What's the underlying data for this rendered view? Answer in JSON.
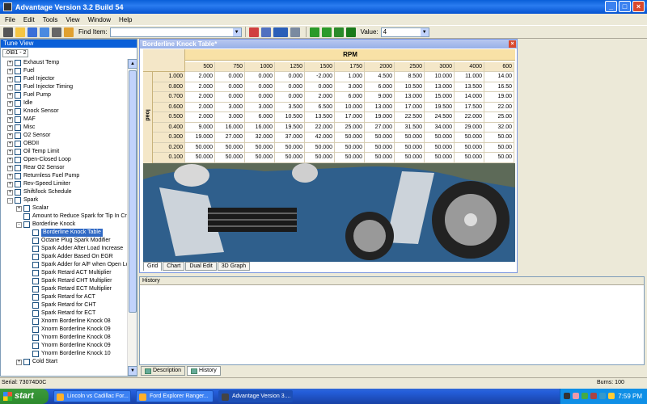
{
  "window": {
    "title": "Advantage Version 3.2 Build 54"
  },
  "menu": [
    "File",
    "Edit",
    "Tools",
    "View",
    "Window",
    "Help"
  ],
  "toolbar": {
    "find_label": "Find Item:",
    "find_value": "",
    "value_label": "Value:",
    "value_value": "4"
  },
  "tune_view": {
    "title": "Tune View",
    "tab": ".0\\B1 - 2",
    "items": [
      {
        "label": "Exhaust Temp",
        "level": 0,
        "exp": "+"
      },
      {
        "label": "Fuel",
        "level": 0,
        "exp": "+"
      },
      {
        "label": "Fuel Injector",
        "level": 0,
        "exp": "+"
      },
      {
        "label": "Fuel Injector Timing",
        "level": 0,
        "exp": "+"
      },
      {
        "label": "Fuel Pump",
        "level": 0,
        "exp": "+"
      },
      {
        "label": "Idle",
        "level": 0,
        "exp": "+"
      },
      {
        "label": "Knock Sensor",
        "level": 0,
        "exp": "+"
      },
      {
        "label": "MAF",
        "level": 0,
        "exp": "+"
      },
      {
        "label": "Misc",
        "level": 0,
        "exp": "+"
      },
      {
        "label": "O2 Sensor",
        "level": 0,
        "exp": "+"
      },
      {
        "label": "OBDII",
        "level": 0,
        "exp": "+"
      },
      {
        "label": "Oil Temp Limit",
        "level": 0,
        "exp": "+"
      },
      {
        "label": "Open-Closed Loop",
        "level": 0,
        "exp": "+"
      },
      {
        "label": "Rear O2 Sensor",
        "level": 0,
        "exp": "+"
      },
      {
        "label": "Returnless Fuel Pump",
        "level": 0,
        "exp": "+"
      },
      {
        "label": "Rev-Speed Limiter",
        "level": 0,
        "exp": "+"
      },
      {
        "label": "Shift/lock Schedule",
        "level": 0,
        "exp": "+"
      },
      {
        "label": "Spark",
        "level": 0,
        "exp": "-"
      },
      {
        "label": "Scalar",
        "level": 1,
        "exp": "+"
      },
      {
        "label": "Amount to Reduce Spark for Tip In Cnt",
        "level": 1,
        "exp": ""
      },
      {
        "label": "Borderline Knock",
        "level": 1,
        "exp": "-"
      },
      {
        "label": "Borderline Knock Table",
        "level": 2,
        "exp": "",
        "selected": true
      },
      {
        "label": "Octane Plug Spark Modifier",
        "level": 2,
        "exp": ""
      },
      {
        "label": "Spark Adder After Load Increase",
        "level": 2,
        "exp": ""
      },
      {
        "label": "Spark Adder Based On EGR",
        "level": 2,
        "exp": ""
      },
      {
        "label": "Spark Adder for A/F when Open Lo",
        "level": 2,
        "exp": ""
      },
      {
        "label": "Spark Retard ACT Multiplier",
        "level": 2,
        "exp": ""
      },
      {
        "label": "Spark Retard CHT Multiplier",
        "level": 2,
        "exp": ""
      },
      {
        "label": "Spark Retard ECT Multiplier",
        "level": 2,
        "exp": ""
      },
      {
        "label": "Spark Retard for ACT",
        "level": 2,
        "exp": ""
      },
      {
        "label": "Spark Retard for CHT",
        "level": 2,
        "exp": ""
      },
      {
        "label": "Spark Retard for ECT",
        "level": 2,
        "exp": ""
      },
      {
        "label": "Xnorm Borderline Knock 08",
        "level": 2,
        "exp": ""
      },
      {
        "label": "Xnorm Borderline Knock 09",
        "level": 2,
        "exp": ""
      },
      {
        "label": "Ynorm Borderline Knock 08",
        "level": 2,
        "exp": ""
      },
      {
        "label": "Ynorm Borderline Knock 09",
        "level": 2,
        "exp": ""
      },
      {
        "label": "Ynorm Borderline Knock 10",
        "level": 2,
        "exp": ""
      },
      {
        "label": "Cold Start",
        "level": 1,
        "exp": "+"
      }
    ]
  },
  "knock_table": {
    "title": "Borderline Knock Table*",
    "rpm_label": "RPM",
    "load_label": "load",
    "rpm": [
      "500",
      "750",
      "1000",
      "1250",
      "1500",
      "1750",
      "2000",
      "2500",
      "3000",
      "4000",
      "600"
    ],
    "rows": [
      {
        "load": "1.000",
        "vals": [
          "2.000",
          "0.000",
          "0.000",
          "0.000",
          "-2.000",
          "1.000",
          "4.500",
          "8.500",
          "10.000",
          "11.000",
          "14.00"
        ]
      },
      {
        "load": "0.800",
        "vals": [
          "2.000",
          "0.000",
          "0.000",
          "0.000",
          "0.000",
          "3.000",
          "6.000",
          "10.500",
          "13.000",
          "13.500",
          "16.50"
        ]
      },
      {
        "load": "0.700",
        "vals": [
          "2.000",
          "0.000",
          "0.000",
          "0.000",
          "2.000",
          "6.000",
          "9.000",
          "13.000",
          "15.000",
          "14.000",
          "19.00"
        ]
      },
      {
        "load": "0.600",
        "vals": [
          "2.000",
          "3.000",
          "3.000",
          "3.500",
          "6.500",
          "10.000",
          "13.000",
          "17.000",
          "19.500",
          "17.500",
          "22.00"
        ]
      },
      {
        "load": "0.500",
        "vals": [
          "2.000",
          "3.000",
          "6.000",
          "10.500",
          "13.500",
          "17.000",
          "19.000",
          "22.500",
          "24.500",
          "22.000",
          "25.00"
        ]
      },
      {
        "load": "0.400",
        "vals": [
          "9.000",
          "16.000",
          "16.000",
          "19.500",
          "22.000",
          "25.000",
          "27.000",
          "31.500",
          "34.000",
          "29.000",
          "32.00"
        ]
      },
      {
        "load": "0.300",
        "vals": [
          "19.000",
          "27.000",
          "32.000",
          "37.000",
          "42.000",
          "50.000",
          "50.000",
          "50.000",
          "50.000",
          "50.000",
          "50.00"
        ]
      },
      {
        "load": "0.200",
        "vals": [
          "50.000",
          "50.000",
          "50.000",
          "50.000",
          "50.000",
          "50.000",
          "50.000",
          "50.000",
          "50.000",
          "50.000",
          "50.00"
        ]
      },
      {
        "load": "0.100",
        "vals": [
          "50.000",
          "50.000",
          "50.000",
          "50.000",
          "50.000",
          "50.000",
          "50.000",
          "50.000",
          "50.000",
          "50.000",
          "50.00"
        ]
      }
    ],
    "tabs": [
      "Grid",
      "Chart",
      "Dual Edit",
      "3D Graph"
    ]
  },
  "history": {
    "title": "History"
  },
  "bottom_tabs": [
    "Description",
    "History"
  ],
  "status": {
    "serial": "Serial: 73074D0C",
    "burns": "Burns: 100"
  },
  "taskbar": {
    "start": "start",
    "tasks": [
      "Lincoln vs Cadillac For...",
      "Ford Explorer Ranger...",
      "Advantage Version 3...."
    ],
    "clock": "7:59 PM"
  }
}
